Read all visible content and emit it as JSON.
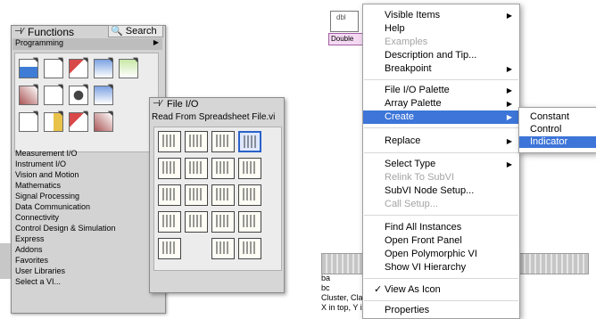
{
  "functions_palette": {
    "title": "Functions",
    "pin_glyph": "⊣⁄",
    "search_label": "Search",
    "category": "Programming",
    "categories": [
      "Measurement I/O",
      "Instrument I/O",
      "Vision and Motion",
      "Mathematics",
      "Signal Processing",
      "Data Communication",
      "Connectivity",
      "Control Design & Simulation",
      "Express",
      "Addons",
      "Favorites",
      "User Libraries",
      "Select a VI..."
    ]
  },
  "file_io_palette": {
    "title": "File I/O",
    "pin_glyph": "⊣⁄",
    "selected_tip": "Read From Spreadsheet File.vi"
  },
  "diagram": {
    "node_label": "Double",
    "node_glyph": "dbl",
    "bottom_lines": [
      "ba",
      "bc",
      "Cluster, Cla",
      "X in top, Y i"
    ]
  },
  "context_menu": {
    "items": [
      {
        "label": "Visible Items",
        "arrow": true
      },
      {
        "label": "Help"
      },
      {
        "label": "Examples",
        "disabled": true
      },
      {
        "label": "Description and Tip..."
      },
      {
        "label": "Breakpoint",
        "arrow": true
      },
      {
        "label": "File I/O Palette",
        "arrow": true
      },
      {
        "label": "Array Palette",
        "arrow": true
      },
      {
        "label": "Create",
        "arrow": true,
        "highlighted": true
      },
      {
        "label": "Replace",
        "arrow": true
      },
      {
        "label": "Select Type",
        "arrow": true
      },
      {
        "label": "Relink To SubVI",
        "disabled": true
      },
      {
        "label": "SubVI Node Setup..."
      },
      {
        "label": "Call Setup...",
        "disabled": true
      },
      {
        "label": "Find All Instances"
      },
      {
        "label": "Open Front Panel"
      },
      {
        "label": "Open Polymorphic VI"
      },
      {
        "label": "Show VI Hierarchy"
      },
      {
        "label": "View As Icon",
        "checked": true
      },
      {
        "label": "Properties"
      }
    ],
    "submenu_arrow": "▶",
    "check_glyph": "✓"
  },
  "create_submenu": {
    "items": [
      {
        "label": "Constant"
      },
      {
        "label": "Control"
      },
      {
        "label": "Indicator",
        "highlighted": true
      }
    ]
  },
  "colors": {
    "menu_highlight": "#3d75d8",
    "palette_bg": "#d3d3d3",
    "selected_icon_border": "#2a62c9"
  }
}
